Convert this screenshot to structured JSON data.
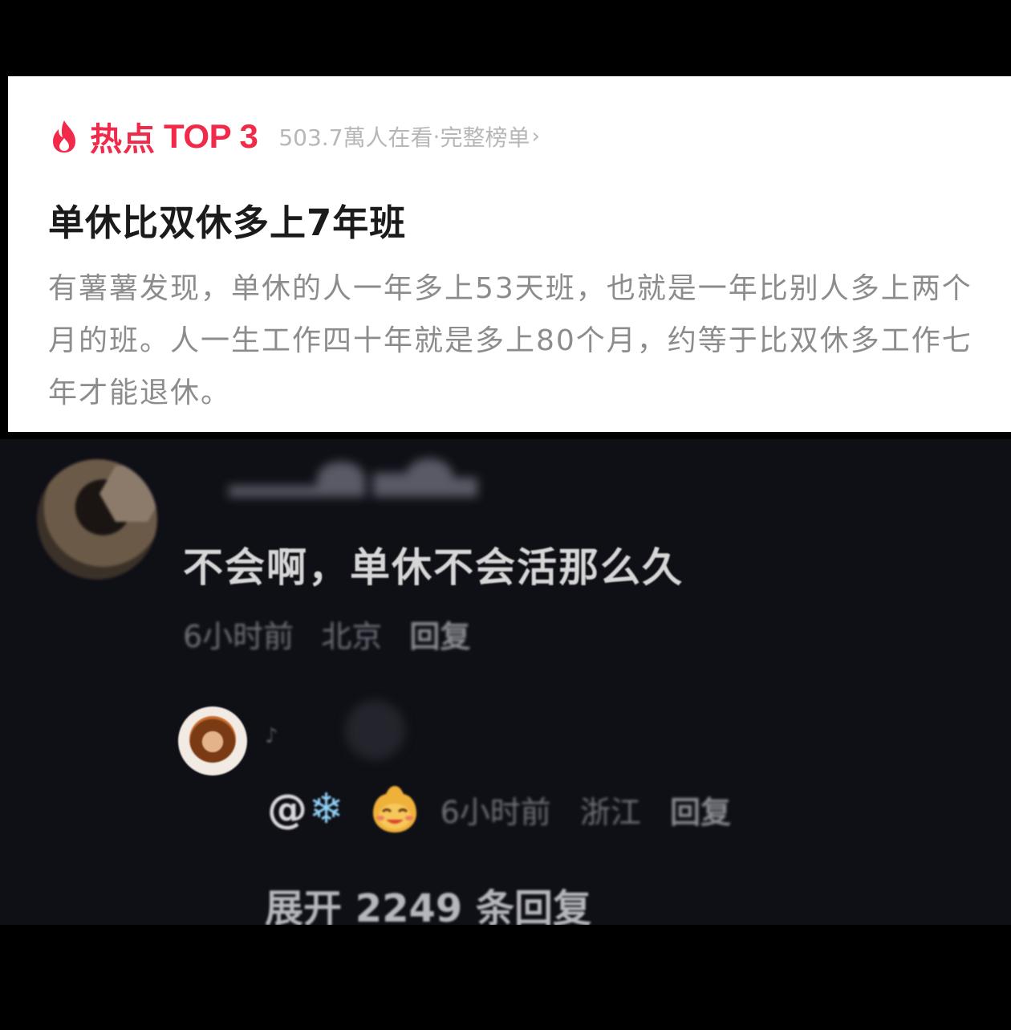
{
  "hot": {
    "label": "热点",
    "rank": "TOP 3",
    "viewers": "503.7萬人在看",
    "separator": "·",
    "full_list_link": "完整榜单",
    "chevron": "›",
    "title": "单休比双休多上7年班",
    "body": "有薯薯发现，单休的人一年多上53天班，也就是一年比别人多上两个月的班。人一生工作四十年就是多上80个月，约等于比双休多工作七年才能退休。",
    "accent_color": "#f22a4a"
  },
  "comment": {
    "text": "不会啊，单休不会活那么久",
    "time": "6小时前",
    "location": "北京",
    "reply_label": "回复"
  },
  "reply": {
    "mark": "♪",
    "mention": "@",
    "snowflake": "❄",
    "time": "6小时前",
    "location": "浙江",
    "reply_label": "回复"
  },
  "expand_replies_label": "展开 2249 条回复"
}
